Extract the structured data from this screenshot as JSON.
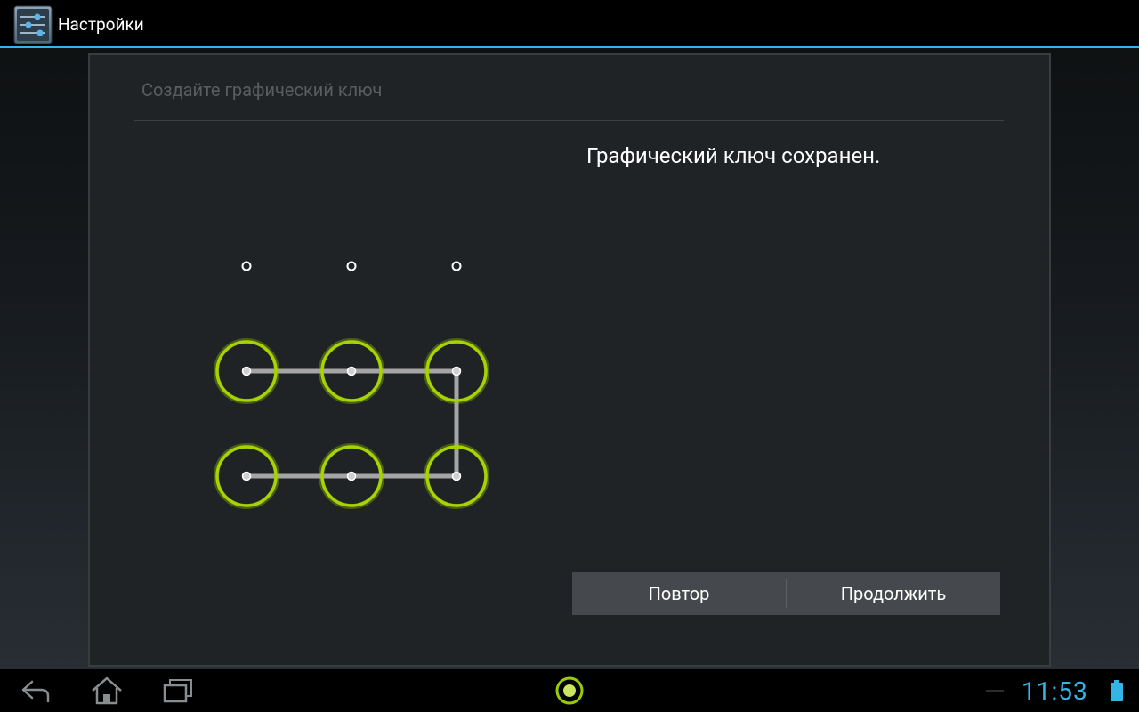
{
  "action_bar": {
    "title": "Настройки",
    "icon": "settings-sliders-icon"
  },
  "dialog": {
    "title": "Создайте графический ключ",
    "message": "Графический ключ сохранен.",
    "buttons": {
      "retry_label": "Повтор",
      "continue_label": "Продолжить"
    },
    "pattern": {
      "grid": "3x3",
      "sequence": [
        4,
        5,
        6,
        9,
        8,
        7
      ],
      "active_color": "#99cc00",
      "line_color": "#b0b0b0"
    }
  },
  "nav_bar": {
    "icons": [
      "back-icon",
      "home-icon",
      "recent-apps-icon",
      "notification-dot-icon",
      "battery-icon"
    ],
    "time": "11:53",
    "accent": "#33b5e5"
  }
}
